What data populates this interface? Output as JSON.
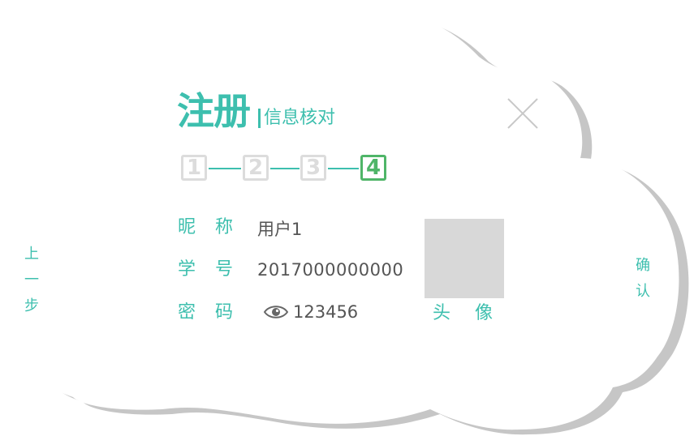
{
  "header": {
    "title": "注册",
    "subtitle": "信息核对"
  },
  "steps": {
    "items": [
      "1",
      "2",
      "3",
      "4"
    ],
    "current": 4,
    "active_color": "#4fb568",
    "inactive_color": "#dcdcdc"
  },
  "form": {
    "nickname": {
      "label": "昵称",
      "value": "用户1"
    },
    "student_id": {
      "label": "学号",
      "value": "2017000000000"
    },
    "password": {
      "label": "密码",
      "value": "123456"
    }
  },
  "avatar": {
    "label": "头像"
  },
  "nav": {
    "prev_chars": [
      "上",
      "一",
      "步"
    ],
    "confirm_chars": [
      "确",
      "认"
    ]
  },
  "icons": {
    "close": "close-icon",
    "eye": "eye-icon"
  },
  "colors": {
    "accent": "#3dbfae",
    "cloud_fill": "#ffffff",
    "cloud_shadow": "#c6c6c6",
    "text": "#555555",
    "avatar_placeholder": "#d8d8d8"
  }
}
